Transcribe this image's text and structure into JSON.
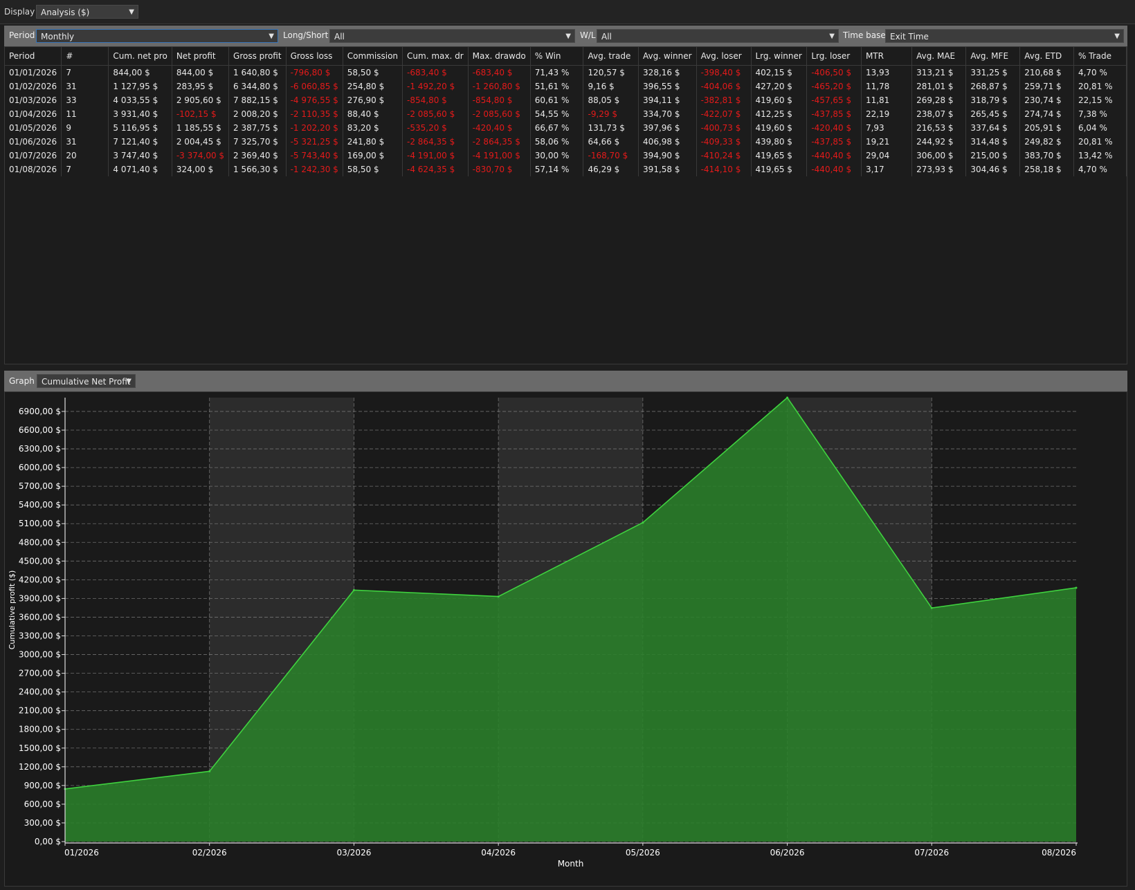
{
  "display": {
    "label": "Display",
    "value": "Analysis ($)"
  },
  "filters": {
    "period_label": "Period",
    "period_value": "Monthly",
    "longshort_label": "Long/Short",
    "longshort_value": "All",
    "wl_label": "W/L",
    "wl_value": "All",
    "timebase_label": "Time base",
    "timebase_value": "Exit Time"
  },
  "table": {
    "columns": [
      "Period",
      "#",
      "Cum. net pro",
      "Net profit",
      "Gross profit",
      "Gross loss",
      "Commission",
      "Cum. max. dr",
      "Max. drawdo",
      "% Win",
      "Avg. trade",
      "Avg. winner",
      "Avg. loser",
      "Lrg. winner",
      "Lrg. loser",
      "MTR",
      "Avg. MAE",
      "Avg. MFE",
      "Avg. ETD",
      "% Trade"
    ],
    "rows": [
      [
        "01/01/2026",
        "7",
        "844,00 $",
        "844,00 $",
        "1 640,80 $",
        "-796,80 $",
        "58,50 $",
        "-683,40 $",
        "-683,40 $",
        "71,43 %",
        "120,57 $",
        "328,16 $",
        "-398,40 $",
        "402,15 $",
        "-406,50 $",
        "13,93",
        "313,21 $",
        "331,25 $",
        "210,68 $",
        "4,70 %"
      ],
      [
        "01/02/2026",
        "31",
        "1 127,95 $",
        "283,95 $",
        "6 344,80 $",
        "-6 060,85 $",
        "254,80 $",
        "-1 492,20 $",
        "-1 260,80 $",
        "51,61 %",
        "9,16 $",
        "396,55 $",
        "-404,06 $",
        "427,20 $",
        "-465,20 $",
        "11,78",
        "281,01 $",
        "268,87 $",
        "259,71 $",
        "20,81 %"
      ],
      [
        "01/03/2026",
        "33",
        "4 033,55 $",
        "2 905,60 $",
        "7 882,15 $",
        "-4 976,55 $",
        "276,90 $",
        "-854,80 $",
        "-854,80 $",
        "60,61 %",
        "88,05 $",
        "394,11 $",
        "-382,81 $",
        "419,60 $",
        "-457,65 $",
        "11,81",
        "269,28 $",
        "318,79 $",
        "230,74 $",
        "22,15 %"
      ],
      [
        "01/04/2026",
        "11",
        "3 931,40 $",
        "-102,15 $",
        "2 008,20 $",
        "-2 110,35 $",
        "88,40 $",
        "-2 085,60 $",
        "-2 085,60 $",
        "54,55 %",
        "-9,29 $",
        "334,70 $",
        "-422,07 $",
        "412,25 $",
        "-437,85 $",
        "22,19",
        "238,07 $",
        "265,45 $",
        "274,74 $",
        "7,38 %"
      ],
      [
        "01/05/2026",
        "9",
        "5 116,95 $",
        "1 185,55 $",
        "2 387,75 $",
        "-1 202,20 $",
        "83,20 $",
        "-535,20 $",
        "-420,40 $",
        "66,67 %",
        "131,73 $",
        "397,96 $",
        "-400,73 $",
        "419,60 $",
        "-420,40 $",
        "7,93",
        "216,53 $",
        "337,64 $",
        "205,91 $",
        "6,04 %"
      ],
      [
        "01/06/2026",
        "31",
        "7 121,40 $",
        "2 004,45 $",
        "7 325,70 $",
        "-5 321,25 $",
        "241,80 $",
        "-2 864,35 $",
        "-2 864,35 $",
        "58,06 %",
        "64,66 $",
        "406,98 $",
        "-409,33 $",
        "439,80 $",
        "-437,85 $",
        "19,21",
        "244,92 $",
        "314,48 $",
        "249,82 $",
        "20,81 %"
      ],
      [
        "01/07/2026",
        "20",
        "3 747,40 $",
        "-3 374,00 $",
        "2 369,40 $",
        "-5 743,40 $",
        "169,00 $",
        "-4 191,00 $",
        "-4 191,00 $",
        "30,00 %",
        "-168,70 $",
        "394,90 $",
        "-410,24 $",
        "419,65 $",
        "-440,40 $",
        "29,04",
        "306,00 $",
        "215,00 $",
        "383,70 $",
        "13,42 %"
      ],
      [
        "01/08/2026",
        "7",
        "4 071,40 $",
        "324,00 $",
        "1 566,30 $",
        "-1 242,30 $",
        "58,50 $",
        "-4 624,35 $",
        "-830,70 $",
        "57,14 %",
        "46,29 $",
        "391,58 $",
        "-414,10 $",
        "419,65 $",
        "-440,40 $",
        "3,17",
        "273,93 $",
        "304,46 $",
        "258,18 $",
        "4,70 %"
      ]
    ]
  },
  "graph": {
    "label": "Graph",
    "value": "Cumulative Net Profit"
  },
  "chart_data": {
    "type": "area",
    "xlabel": "Month",
    "ylabel": "Cumulative profit ($)",
    "categories": [
      "01/2026",
      "02/2026",
      "03/2026",
      "04/2026",
      "05/2026",
      "06/2026",
      "07/2026",
      "08/2026"
    ],
    "values": [
      844.0,
      1127.95,
      4033.55,
      3931.4,
      5116.95,
      7121.4,
      3747.4,
      4071.4
    ],
    "y_ticks": [
      "0,00 $",
      "300,00 $",
      "600,00 $",
      "900,00 $",
      "1200,00 $",
      "1500,00 $",
      "1800,00 $",
      "2100,00 $",
      "2400,00 $",
      "2700,00 $",
      "3000,00 $",
      "3300,00 $",
      "3600,00 $",
      "3900,00 $",
      "4200,00 $",
      "4500,00 $",
      "4800,00 $",
      "5100,00 $",
      "5400,00 $",
      "5700,00 $",
      "6000,00 $",
      "6300,00 $",
      "6600,00 $",
      "6900,00 $"
    ],
    "y_tick_values": [
      0,
      300,
      600,
      900,
      1200,
      1500,
      1800,
      2100,
      2400,
      2700,
      3000,
      3300,
      3600,
      3900,
      4200,
      4500,
      4800,
      5100,
      5400,
      5700,
      6000,
      6300,
      6600,
      6900
    ],
    "ylim": [
      0,
      7121.4
    ],
    "grid": true,
    "colors": {
      "fill": "#2a7f2a",
      "line": "#3fd23f",
      "band": "#2c2c2c"
    }
  }
}
